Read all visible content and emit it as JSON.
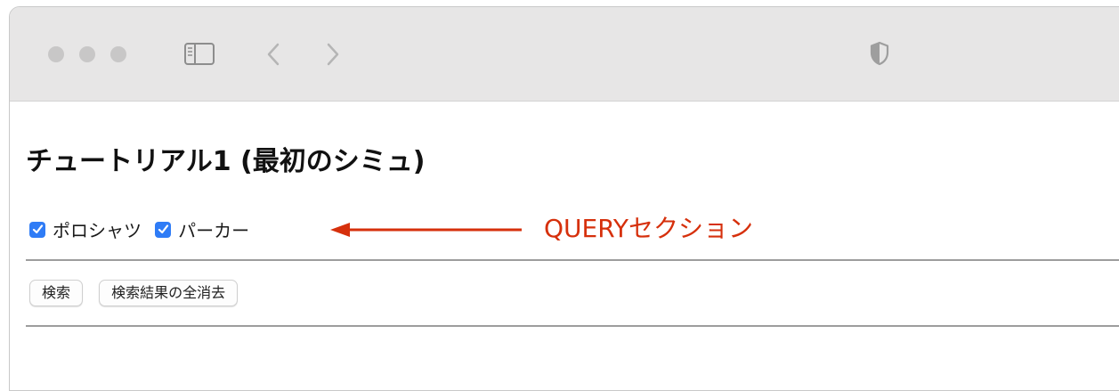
{
  "browser": {
    "icons": [
      "window-close-icon",
      "window-minimize-icon",
      "window-zoom-icon",
      "sidebar-icon",
      "chevron-left-icon",
      "chevron-right-icon",
      "shield-icon"
    ]
  },
  "page": {
    "title": "チュートリアル1 (最初のシミュ)"
  },
  "query": {
    "checkboxes": [
      {
        "label": "ポロシャツ",
        "checked": true
      },
      {
        "label": "パーカー",
        "checked": true
      }
    ],
    "checkbox_color": "#2f7cf6"
  },
  "annotation": {
    "text": "QUERYセクション",
    "color": "#d6300c"
  },
  "buttons": {
    "search": "検索",
    "clear_results": "検索結果の全消去"
  }
}
